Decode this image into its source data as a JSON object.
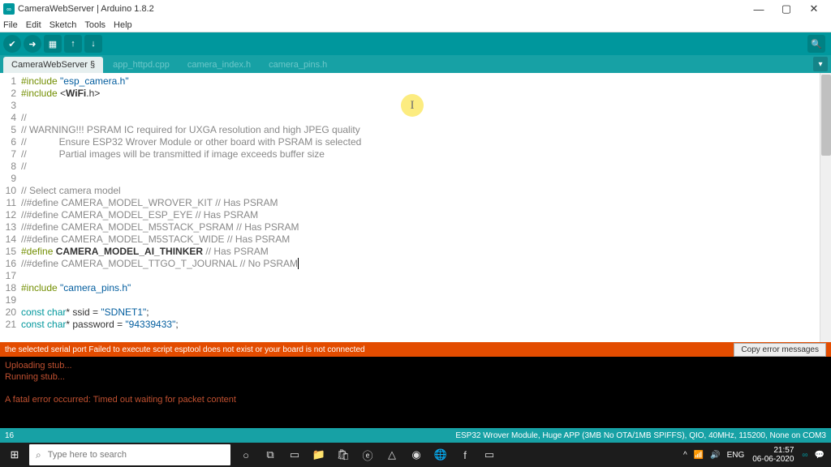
{
  "title": "CameraWebServer | Arduino 1.8.2",
  "menu": {
    "file": "File",
    "edit": "Edit",
    "sketch": "Sketch",
    "tools": "Tools",
    "help": "Help"
  },
  "tabs": {
    "t0": "CameraWebServer §",
    "t1": "app_httpd.cpp",
    "t2": "camera_index.h",
    "t3": "camera_pins.h"
  },
  "code": {
    "l1a": "#include",
    "l1b": " \"esp_camera.h\"",
    "l2a": "#include",
    "l2b": " <",
    "l2c": "WiFi",
    "l2d": ".h>",
    "l4": "//",
    "l5": "// WARNING!!! PSRAM IC required for UXGA resolution and high JPEG quality",
    "l6": "//            Ensure ESP32 Wrover Module or other board with PSRAM is selected",
    "l7": "//            Partial images will be transmitted if image exceeds buffer size",
    "l8": "//",
    "l10": "// Select camera model",
    "l11": "//#define CAMERA_MODEL_WROVER_KIT // Has PSRAM",
    "l12": "//#define CAMERA_MODEL_ESP_EYE // Has PSRAM",
    "l13": "//#define CAMERA_MODEL_M5STACK_PSRAM // Has PSRAM",
    "l14": "//#define CAMERA_MODEL_M5STACK_WIDE // Has PSRAM",
    "l15a": "#define",
    "l15b": " CAMERA_MODEL_AI_THINKER ",
    "l15c": "// Has PSRAM",
    "l16": "//#define CAMERA_MODEL_TTGO_T_JOURNAL // No PSRAM",
    "l18a": "#include",
    "l18b": " \"camera_pins.h\"",
    "l20a": "const",
    "l20b": " char",
    "l20c": "* ssid = ",
    "l20d": "\"SDNET1\"",
    "l20e": ";",
    "l21a": "const",
    "l21b": " char",
    "l21c": "* password = ",
    "l21d": "\"94339433\"",
    "l21e": ";"
  },
  "lines": {
    "1": "1",
    "2": "2",
    "3": "3",
    "4": "4",
    "5": "5",
    "6": "6",
    "7": "7",
    "8": "8",
    "9": "9",
    "10": "10",
    "11": "11",
    "12": "12",
    "13": "13",
    "14": "14",
    "15": "15",
    "16": "16",
    "17": "17",
    "18": "18",
    "19": "19",
    "20": "20",
    "21": "21"
  },
  "error": {
    "msg": "the selected serial port Failed to execute script esptool does not exist or your board is not connected",
    "copy": "Copy error messages"
  },
  "console": {
    "l1": "Uploading stub...",
    "l2": "Running stub...",
    "l4": "A fatal error occurred: Timed out waiting for packet content"
  },
  "status": {
    "left": "16",
    "right": "ESP32 Wrover Module, Huge APP (3MB No OTA/1MB SPIFFS), QIO, 40MHz, 115200, None on COM3"
  },
  "taskbar": {
    "search": "Type here to search",
    "lang": "ENG",
    "time": "21:57",
    "date": "06-06-2020"
  },
  "cursor": "I"
}
